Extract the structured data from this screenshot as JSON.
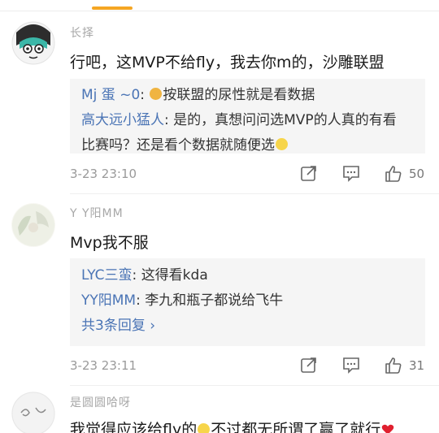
{
  "comments": [
    {
      "username": "长择",
      "text": "行吧，这MVP不给fly，我去你m的，沙雕联盟",
      "replies": [
        {
          "user": "Mj 蛋 ~0",
          "text": "按联盟的尿性就是看数据"
        },
        {
          "user": "高大远小猛人",
          "text": "是的，真想问问选MVP的人真的有看"
        },
        {
          "user": "",
          "text": "比赛吗？还是看个数据就随便选"
        }
      ],
      "time": "3-23 23:10",
      "likes": "50"
    },
    {
      "username": "Y Y阳MM",
      "text": "Mvp我不服",
      "replies": [
        {
          "user": "LYC三蛮",
          "text": "这得看kda"
        },
        {
          "user": "YY阳MM",
          "text": "李九和瓶子都说给飞牛"
        }
      ],
      "more_replies": "共3条回复",
      "time": "3-23 23:11",
      "likes": "31"
    },
    {
      "username": "是圆圆哈呀",
      "text": "我觉得应该给fly的",
      "text_tail": "不过都无所谓了赢了就行"
    }
  ]
}
